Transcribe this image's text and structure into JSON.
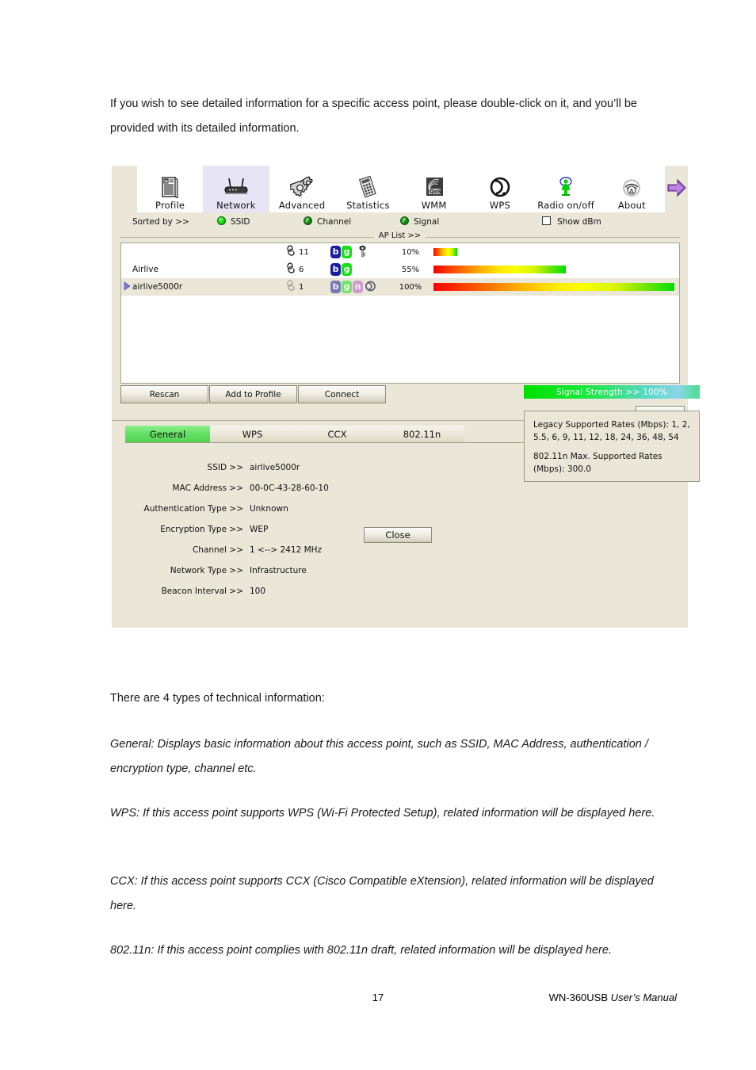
{
  "document": {
    "intro": "If you wish to see detailed information for a specific access point, please double-click on it, and you’ll be provided with its detailed information.",
    "types_lead": "There are 4 types of technical information:",
    "general_desc": "General: Displays basic information about this access point, such as SSID, MAC Address, authentication / encryption type, channel etc.",
    "wps_desc": "WPS: If this access point supports WPS (Wi-Fi Protected Setup), related information will be displayed here.",
    "ccx_desc": "CCX: If this access point supports CCX (Cisco Compatible eXtension), related information will be displayed here.",
    "n_desc": "802.11n: If this access point complies with 802.11n draft, related information will be displayed here.",
    "page_number": "17",
    "footer_model": "WN-360USB",
    "footer_manual": "User’s Manual"
  },
  "app": {
    "toolbar": {
      "items": [
        {
          "label": "Profile",
          "icon": "profile-icon",
          "active": false
        },
        {
          "label": "Network",
          "icon": "router-icon",
          "active": true
        },
        {
          "label": "Advanced",
          "icon": "gears-icon",
          "active": false
        },
        {
          "label": "Statistics",
          "icon": "calculator-icon",
          "active": false
        },
        {
          "label": "WMM",
          "icon": "qos-icon",
          "active": false
        },
        {
          "label": "WPS",
          "icon": "wps-icon",
          "active": false
        },
        {
          "label": "Radio on/off",
          "icon": "radio-tower-icon",
          "active": false
        },
        {
          "label": "About",
          "icon": "about-icon",
          "active": false
        }
      ],
      "next_arrow_icon": "arrow-right-icon"
    },
    "sortbar": {
      "label": "Sorted by >>",
      "options": [
        {
          "label": "SSID",
          "selected": true
        },
        {
          "label": "Channel",
          "selected": false
        },
        {
          "label": "Signal",
          "selected": false
        }
      ],
      "show_dbm_label": "Show dBm",
      "show_dbm_checked": false
    },
    "ap_list": {
      "header": "AP List >>",
      "rows": [
        {
          "ssid": "",
          "channel": "11",
          "modes": [
            "b",
            "g"
          ],
          "dimmed": false,
          "secured": true,
          "signal_pct": "10%",
          "signal_value": 10,
          "selected": false
        },
        {
          "ssid": "Airlive",
          "channel": "6",
          "modes": [
            "b",
            "g"
          ],
          "dimmed": false,
          "secured": false,
          "signal_pct": "55%",
          "signal_value": 55,
          "selected": false
        },
        {
          "ssid": "airlive5000r",
          "channel": "1",
          "modes": [
            "b",
            "g",
            "n"
          ],
          "dimmed": true,
          "wps": true,
          "secured": false,
          "signal_pct": "100%",
          "signal_value": 100,
          "selected": true
        }
      ]
    },
    "buttons": {
      "rescan": "Rescan",
      "add_to_profile": "Add to Profile",
      "connect": "Connect",
      "collapse_icon": "triangle-up-icon"
    },
    "detail": {
      "tabs": [
        {
          "label": "General",
          "active": true
        },
        {
          "label": "WPS",
          "active": false
        },
        {
          "label": "CCX",
          "active": false
        },
        {
          "label": "802.11n",
          "active": false
        }
      ],
      "fields": [
        {
          "key": "SSID >>",
          "value": "airlive5000r"
        },
        {
          "key": "MAC Address >>",
          "value": "00-0C-43-28-60-10"
        },
        {
          "key": "Authentication Type >>",
          "value": "Unknown"
        },
        {
          "key": "Encryption Type >>",
          "value": "WEP"
        },
        {
          "key": "Channel >>",
          "value": "1 <--> 2412 MHz"
        },
        {
          "key": "Network Type >>",
          "value": "Infrastructure"
        },
        {
          "key": "Beacon Interval >>",
          "value": "100"
        }
      ],
      "signal_strength_label": "Signal Strength >> 100%",
      "rates_legacy": "Legacy Supported Rates (Mbps): 1, 2, 5.5, 6, 9, 11, 12, 18, 24, 36, 48, 54",
      "rates_11n": "802.11n Max. Supported Rates (Mbps): 300.0",
      "close_label": "Close"
    },
    "colors": {
      "window_bg": "#eae7d8",
      "active_tab": "#63e063",
      "accent_blue_badge": "#1c1c9e",
      "accent_green_badge": "#17e017",
      "accent_purple_badge": "#c060c8"
    }
  }
}
